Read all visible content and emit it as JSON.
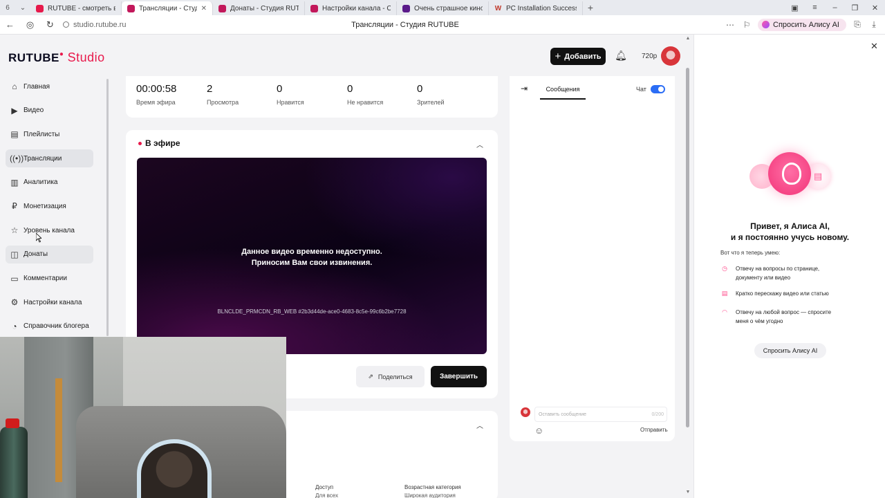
{
  "browser": {
    "tabs": [
      {
        "label": "RUTUBE - смотреть виде",
        "active": false,
        "icon": "rutube-favicon"
      },
      {
        "label": "Трансляции - Студия R",
        "active": true,
        "icon": "rutube-studio-favicon"
      },
      {
        "label": "Донаты - Студия RUTUB",
        "active": false,
        "icon": "rutube-studio-favicon"
      },
      {
        "label": "Настройки канала - Студ",
        "active": false,
        "icon": "rutube-studio-favicon"
      },
      {
        "label": "Очень страшное кино 6 |",
        "active": false,
        "icon": "film-favicon"
      },
      {
        "label": "PC Installation Successful",
        "active": false,
        "icon": "pc-favicon"
      }
    ],
    "url": "studio.rutube.ru",
    "page_title": "Трансляции - Студия RUTUBE",
    "alice_button": "Спросить Алису AI"
  },
  "header": {
    "logo_main": "RUTUBE",
    "logo_studio": "Studio",
    "add_button": "Добавить",
    "resolution": "720p"
  },
  "sidebar": {
    "items": [
      {
        "label": "Главная",
        "icon": "home-icon"
      },
      {
        "label": "Видео",
        "icon": "video-icon"
      },
      {
        "label": "Плейлисты",
        "icon": "playlist-icon"
      },
      {
        "label": "Трансляции",
        "icon": "broadcast-icon"
      },
      {
        "label": "Аналитика",
        "icon": "analytics-icon"
      },
      {
        "label": "Монетизация",
        "icon": "monetization-icon"
      },
      {
        "label": "Уровень канала",
        "icon": "level-icon"
      },
      {
        "label": "Донаты",
        "icon": "donate-icon"
      },
      {
        "label": "Комментарии",
        "icon": "comments-icon"
      },
      {
        "label": "Настройки канала",
        "icon": "settings-icon"
      },
      {
        "label": "Справочник блогера",
        "icon": "handbook-icon"
      }
    ]
  },
  "stats": [
    {
      "value": "00:00:58",
      "label": "Время эфира"
    },
    {
      "value": "2",
      "label": "Просмотра"
    },
    {
      "value": "0",
      "label": "Нравится"
    },
    {
      "value": "0",
      "label": "Не нравится"
    },
    {
      "value": "0",
      "label": "Зрителей"
    }
  ],
  "live": {
    "title": "В эфире",
    "player_msg_1": "Данное видео временно недоступно.",
    "player_msg_2": "Приносим Вам свои извинения.",
    "player_code": "BLNCLDE_PRMCDN_RB_WEB #2b3d44de-ace0-4683-8c5e-99c6b2be7728",
    "share_button": "Поделиться",
    "end_button": "Завершить"
  },
  "lower": {
    "access_label": "Доступ",
    "access_value": "Для всех",
    "age_label": "Возрастная категория",
    "age_value": "Широкая аудитория"
  },
  "chat": {
    "tab_label": "Сообщения",
    "toggle_label": "Чат",
    "input_placeholder": "Оставить сообщение",
    "counter": "0/200",
    "send_label": "Отправить"
  },
  "alice": {
    "greeting_1": "Привет, я Алиса AI,",
    "greeting_2": "и я постоянно учусь новому.",
    "can_title": "Вот что я теперь умею:",
    "features": [
      {
        "line1": "Отвечу на вопросы по странице,",
        "line2": "документу или видео"
      },
      {
        "line1": "Кратко перескажу видео или статью",
        "line2": ""
      },
      {
        "line1": "Отвечу на любой вопрос — спросите",
        "line2": "меня о чём угодно"
      }
    ],
    "ask_button": "Спросить Алису AI"
  },
  "colors": {
    "accent": "#e8194b",
    "dark_button": "#111111",
    "toggle_on": "#2b6df5"
  }
}
